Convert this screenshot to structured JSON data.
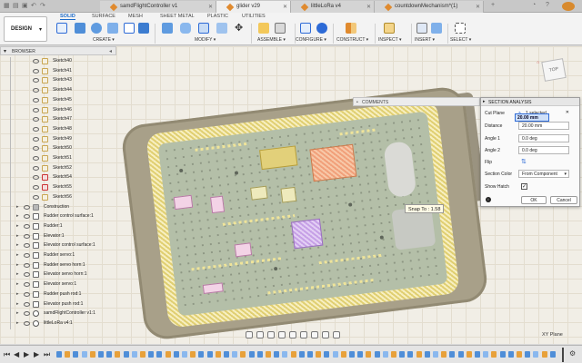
{
  "tabs": [
    {
      "label": "samdFlightController v1",
      "active": false
    },
    {
      "label": "glider v29",
      "active": true
    },
    {
      "label": "littleLoRa v4",
      "active": false
    },
    {
      "label": "countdownMechanism*(1)",
      "active": false
    }
  ],
  "ribbon": {
    "workspace": "DESIGN",
    "workspace_tabs": [
      "SOLID",
      "SURFACE",
      "MESH",
      "SHEET METAL",
      "PLASTIC",
      "UTILITIES"
    ],
    "active_tab": "SOLID",
    "groups": [
      "CREATE",
      "MODIFY",
      "ASSEMBLE",
      "CONFIGURE",
      "CONSTRUCT",
      "INSPECT",
      "INSERT",
      "SELECT"
    ]
  },
  "browser": {
    "title": "BROWSER",
    "items": [
      {
        "label": "Sketch40",
        "type": "sketch"
      },
      {
        "label": "Sketch41",
        "type": "sketch"
      },
      {
        "label": "Sketch43",
        "type": "sketch"
      },
      {
        "label": "Sketch44",
        "type": "sketch"
      },
      {
        "label": "Sketch45",
        "type": "sketch"
      },
      {
        "label": "Sketch46",
        "type": "sketch"
      },
      {
        "label": "Sketch47",
        "type": "sketch"
      },
      {
        "label": "Sketch48",
        "type": "sketch"
      },
      {
        "label": "Sketch49",
        "type": "sketch"
      },
      {
        "label": "Sketch50",
        "type": "sketch"
      },
      {
        "label": "Sketch51",
        "type": "sketch"
      },
      {
        "label": "Sketch52",
        "type": "sketch"
      },
      {
        "label": "Sketch54",
        "type": "sketch-error"
      },
      {
        "label": "Sketch55",
        "type": "sketch-error"
      },
      {
        "label": "Sketch56",
        "type": "sketch"
      },
      {
        "label": "Construction",
        "type": "folder"
      },
      {
        "label": "Rudder control surface:1",
        "type": "component"
      },
      {
        "label": "Rudder:1",
        "type": "component"
      },
      {
        "label": "Elevator:1",
        "type": "component"
      },
      {
        "label": "Elevator control surface:1",
        "type": "component"
      },
      {
        "label": "Rudder servo:1",
        "type": "component"
      },
      {
        "label": "Rudder servo horn:1",
        "type": "component"
      },
      {
        "label": "Elevator servo horn:1",
        "type": "component"
      },
      {
        "label": "Elevator servo:1",
        "type": "component"
      },
      {
        "label": "Rudder push rod:1",
        "type": "component"
      },
      {
        "label": "Elevator push rod:1",
        "type": "component"
      },
      {
        "label": "samdFlightController v1:1",
        "type": "link"
      },
      {
        "label": "littleLoRa v4:1",
        "type": "link"
      }
    ]
  },
  "comments": {
    "title": "COMMENTS"
  },
  "section_analysis": {
    "title": "SECTION ANALYSIS",
    "cut_plane_label": "Cut Plane",
    "cut_plane_value": "1 selected",
    "distance_label": "Distance",
    "distance_value": "20.00 mm",
    "distance_tooltip": "20.00 mm",
    "angle1_label": "Angle 1",
    "angle1_value": "0.0 deg",
    "angle2_label": "Angle 2",
    "angle2_value": "0.0 deg",
    "flip_label": "Flip",
    "section_color_label": "Section Color",
    "section_color_value": "From Component",
    "show_hatch_label": "Show Hatch",
    "show_hatch_checked": true,
    "ok_label": "OK",
    "cancel_label": "Cancel"
  },
  "viewport": {
    "snap_tooltip": "Snap To : 1.58",
    "plane_label": "XY Plane",
    "viewcube_face": "TOP"
  },
  "colors": {
    "accent": "#1b6ac9",
    "hatch": "#e0cf72",
    "board": "#b4bfa8"
  }
}
